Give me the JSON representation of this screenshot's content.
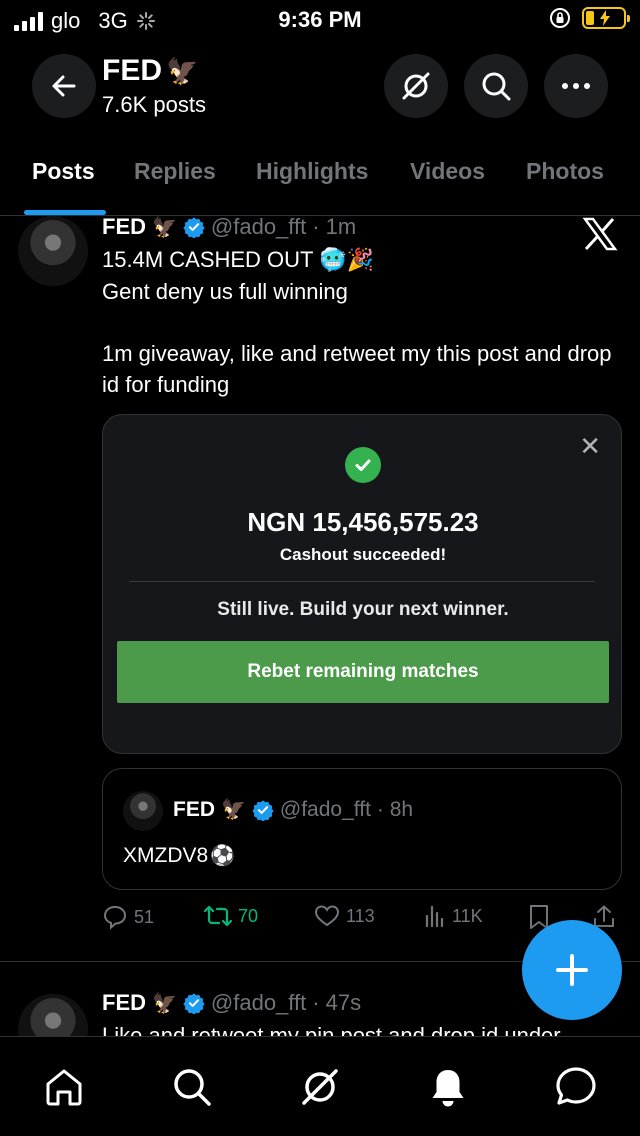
{
  "status_bar": {
    "carrier": "glo",
    "network": "3G",
    "time": "9:36 PM"
  },
  "header": {
    "title": "FED",
    "title_emoji": "🦅",
    "post_count": "7.6K posts"
  },
  "tabs": [
    {
      "label": "Posts",
      "active": true
    },
    {
      "label": "Replies",
      "active": false
    },
    {
      "label": "Highlights",
      "active": false
    },
    {
      "label": "Videos",
      "active": false
    },
    {
      "label": "Photos",
      "active": false
    }
  ],
  "post1": {
    "name": "FED",
    "name_emoji": "🦅",
    "handle": "@fado_fft",
    "time": "· 1m",
    "line1": "15.4M CASHED OUT 🥶🎉",
    "line2": "Gent deny us full winning",
    "line3": "1m giveaway, like and retweet my this post and drop id for funding",
    "media": {
      "amount": "NGN 15,456,575.23",
      "status": "Cashout succeeded!",
      "tagline": "Still live. Build your next winner.",
      "button": "Rebet remaining matches"
    },
    "quote": {
      "name": "FED",
      "name_emoji": "🦅",
      "handle": "@fado_fft",
      "time": "· 8h",
      "text": "XMZDV8",
      "text_emoji": "⚽"
    },
    "actions": {
      "replies": "51",
      "retweets": "70",
      "likes": "113",
      "views": "11K"
    }
  },
  "post2": {
    "name": "FED",
    "name_emoji": "🦅",
    "handle": "@fado_fft",
    "time": "· 47s",
    "text_partial": "Like and retweet my pin post and drop id under"
  },
  "colors": {
    "accent": "#1d9bf0",
    "retweet_green": "#00ba7c",
    "button_green": "#4c9b4a",
    "background": "#000000"
  }
}
